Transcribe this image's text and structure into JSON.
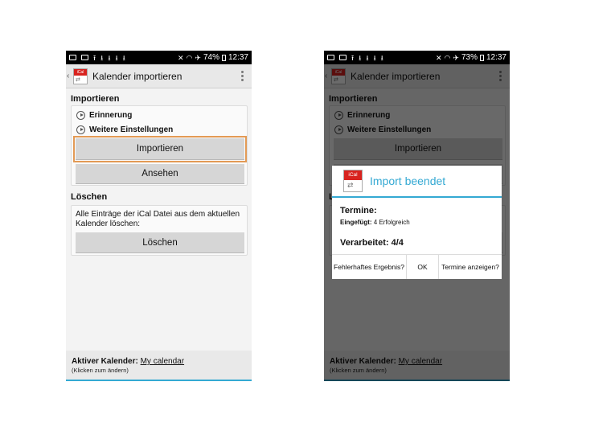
{
  "status_bar": {
    "left": {
      "battery": "74%",
      "time": "12:37"
    },
    "right": {
      "battery": "73%",
      "time": "12:37"
    }
  },
  "app": {
    "title": "Kalender importieren",
    "icon_label": "iCal"
  },
  "import_section": {
    "heading": "Importieren",
    "expanders": [
      "Erinnerung",
      "Weitere Einstellungen"
    ],
    "import_button": "Importieren",
    "view_button": "Ansehen"
  },
  "delete_section": {
    "heading": "Löschen",
    "description": "Alle Einträge der iCal Datei aus dem aktuellen Kalender löschen:",
    "delete_button": "Löschen"
  },
  "footer": {
    "label": "Aktiver Kalender:",
    "calendar": "My calendar",
    "hint": "(Klicken zum ändern)"
  },
  "dialog": {
    "title": "Import beendet",
    "termine_label": "Termine:",
    "inserted_label": "Eingefügt:",
    "inserted_value": "4 Erfolgreich",
    "processed_label": "Verarbeitet: 4/4",
    "actions": {
      "faulty": "Fehlerhaftes Ergebnis?",
      "ok": "OK",
      "show": "Termine anzeigen?"
    }
  },
  "colors": {
    "accent": "#34a9d3",
    "focus": "#e39a55",
    "icon_red": "#d8231f"
  },
  "icons": [
    "notification-icon",
    "image-icon",
    "upload-icon",
    "download-icon",
    "mute-icon",
    "wifi-icon",
    "airplane-icon",
    "battery-icon",
    "overflow-menu-icon",
    "expand-arrow-icon"
  ]
}
